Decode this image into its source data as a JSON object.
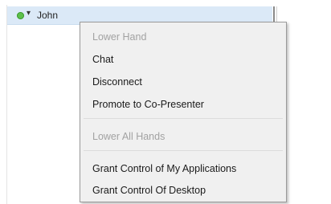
{
  "participant_list": {
    "row": {
      "status_icon": "green-status-dot-icon",
      "status_color": "#5cc04a",
      "chevron": "▾",
      "name": "John"
    }
  },
  "context_menu": {
    "items": [
      {
        "label": "Lower Hand",
        "enabled": false
      },
      {
        "label": "Chat",
        "enabled": true
      },
      {
        "label": "Disconnect",
        "enabled": true
      },
      {
        "label": "Promote to Co-Presenter",
        "enabled": true
      },
      {
        "label": "Lower All Hands",
        "enabled": false
      },
      {
        "label": "Grant Control of My Applications",
        "enabled": true
      },
      {
        "label": "Grant Control Of Desktop",
        "enabled": true
      }
    ]
  }
}
